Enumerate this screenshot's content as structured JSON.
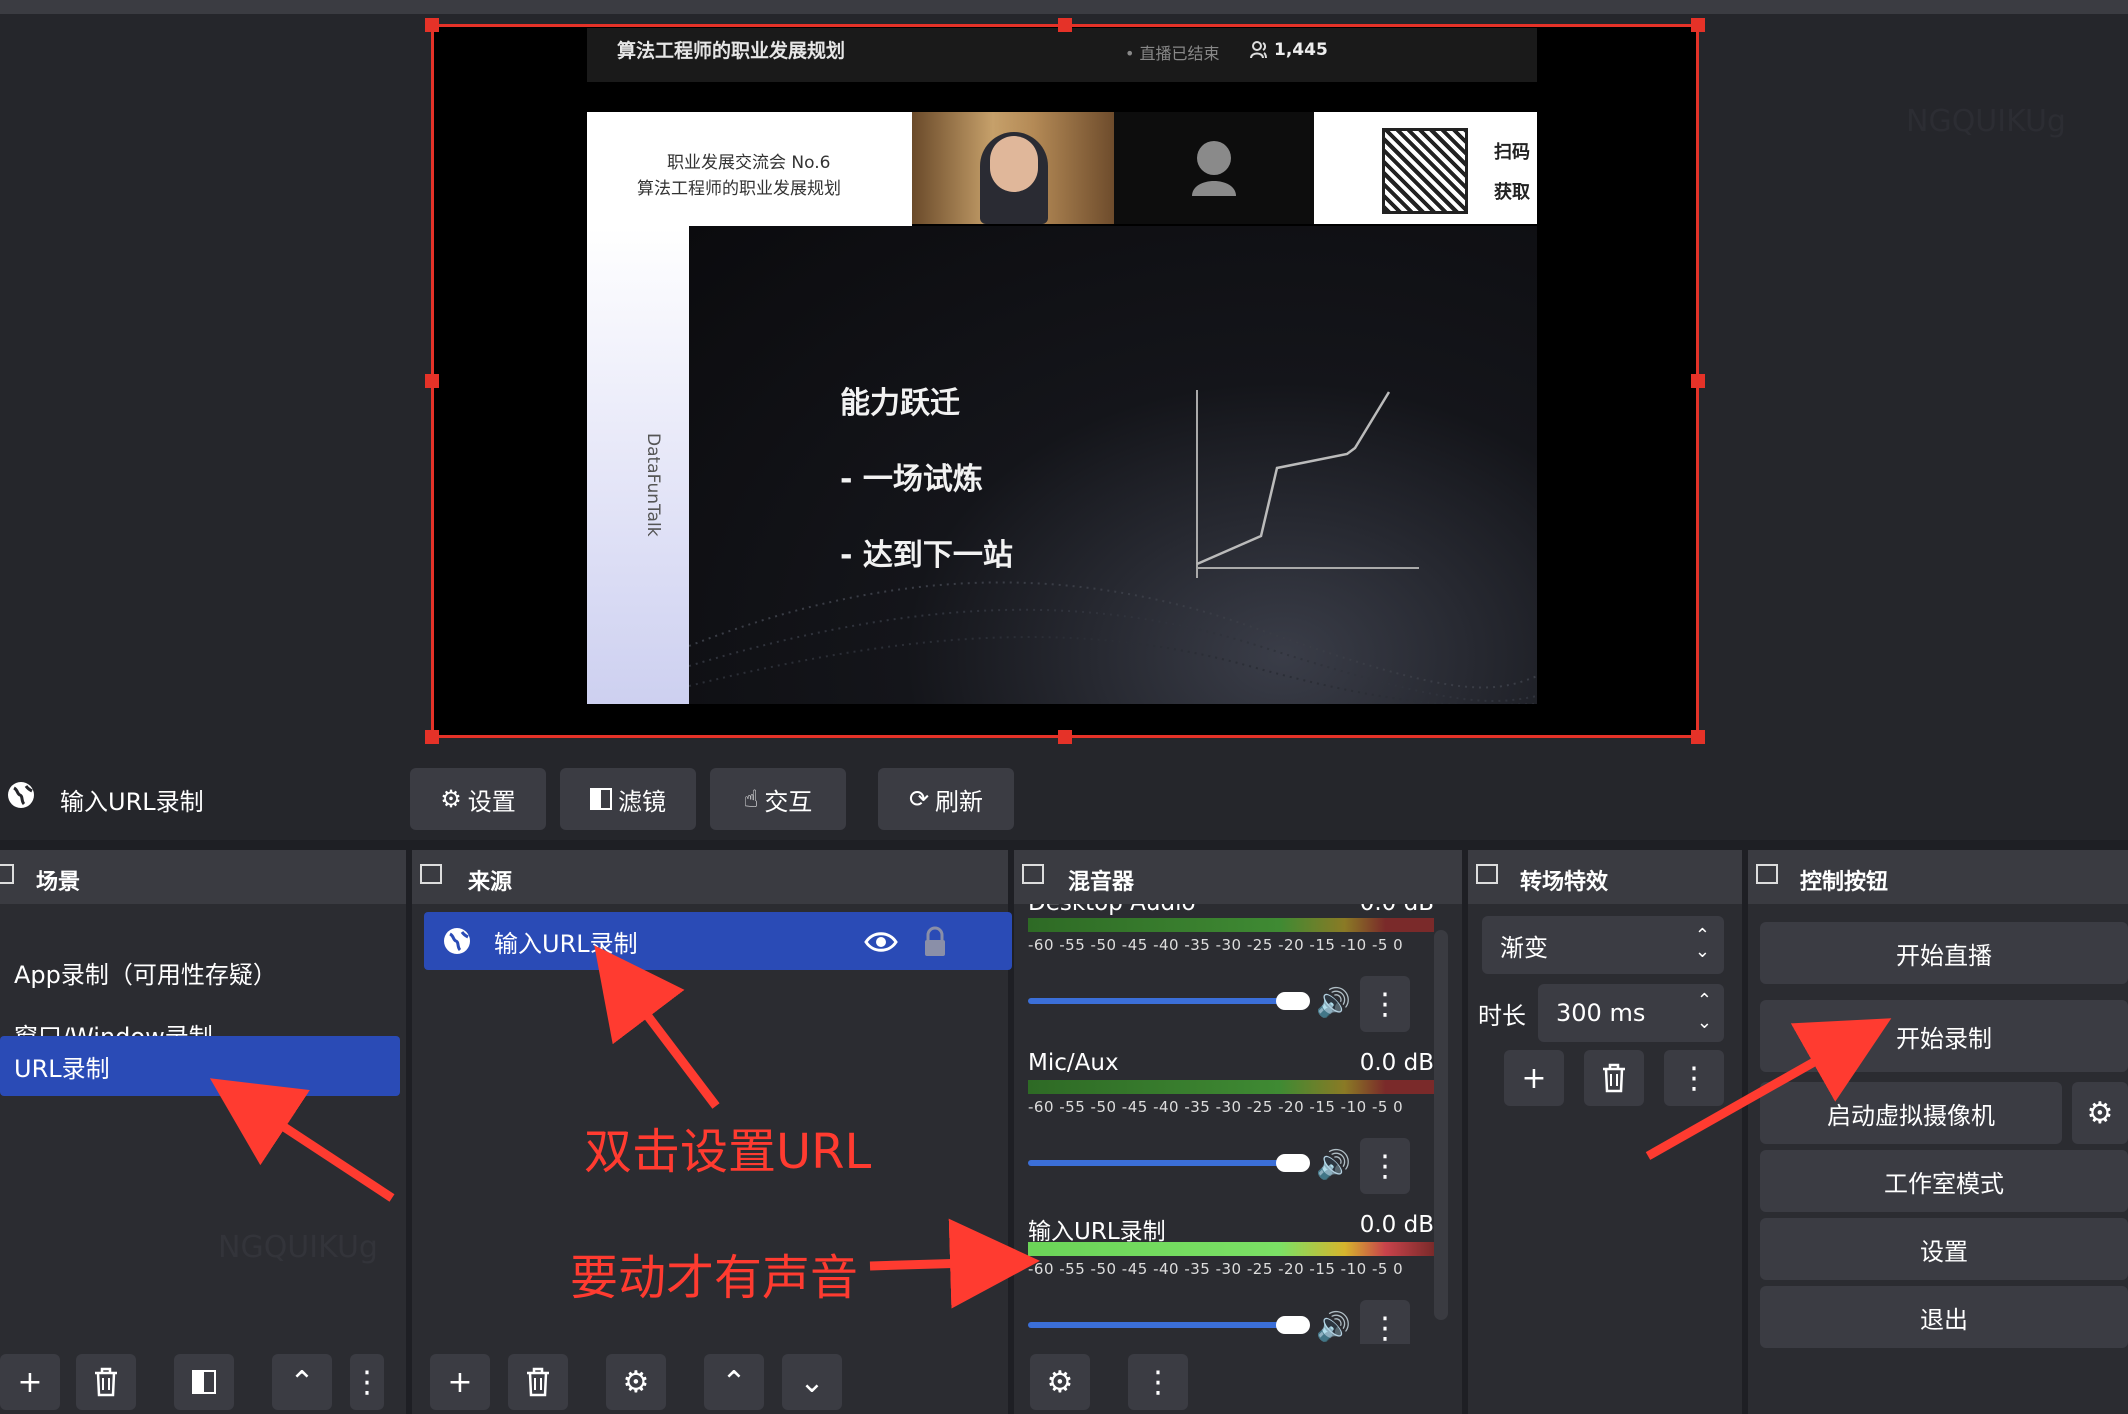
{
  "preview": {
    "web_title": "算法工程师的职业发展规划",
    "web_status": "• 直播已结束",
    "web_viewers": "1,445",
    "event_line1": "职业发展交流会 No.6",
    "event_line2": "算法工程师的职业发展规划",
    "brand": "DataFunTalk",
    "qr_text1": "扫码",
    "qr_text2": "获取",
    "slide_lines": [
      "能力跃迁",
      "- 一场试炼",
      "- 达到下一站"
    ],
    "watermark": "NGQUIKUg"
  },
  "source_toolbar": {
    "source_name": "输入URL录制",
    "settings": "设置",
    "filters": "滤镜",
    "interact": "交互",
    "refresh": "刷新"
  },
  "scenes": {
    "title": "场景",
    "items": [
      "App录制（可用性存疑）",
      "窗口/Window录制",
      "URL录制"
    ],
    "watermark": "NGQUIKUg"
  },
  "sources": {
    "title": "来源",
    "items": [
      "输入URL录制"
    ]
  },
  "mixer": {
    "title": "混音器",
    "ticks": "-60 -55 -50 -45 -40 -35 -30 -25 -20 -15 -10 -5 0",
    "channels": [
      {
        "name": "Desktop Audio",
        "db": "0.0 dB"
      },
      {
        "name": "Mic/Aux",
        "db": "0.0 dB"
      },
      {
        "name": "输入URL录制",
        "db": "0.0 dB"
      }
    ]
  },
  "transitions": {
    "title": "转场特效",
    "type": "渐变",
    "duration_label": "时长",
    "duration_value": "300 ms"
  },
  "controls": {
    "title": "控制按钮",
    "start_stream": "开始直播",
    "start_record": "开始录制",
    "virtual_cam": "启动虚拟摄像机",
    "studio_mode": "工作室模式",
    "settings": "设置",
    "exit": "退出"
  },
  "annotations": {
    "double_click": "双击设置URL",
    "need_motion": "要动才有声音"
  },
  "colors": {
    "accent_selected": "#2a4bb6",
    "annotation_red": "#ff3b30",
    "selection_border": "#e53228"
  }
}
